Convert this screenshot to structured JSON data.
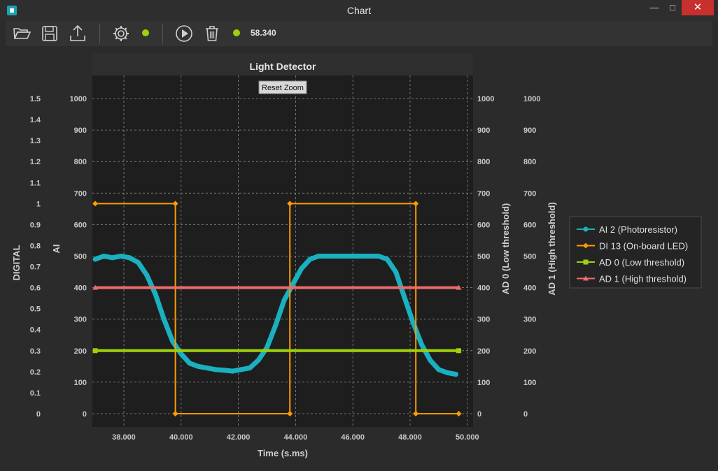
{
  "window": {
    "title": "Chart"
  },
  "toolbar": {
    "icons": [
      "folder-open-icon",
      "save-icon",
      "export-icon",
      "gear-icon",
      "status-dot",
      "play-icon",
      "trash-icon",
      "status-dot"
    ],
    "value": "58.340",
    "status_color": "#9fd10b"
  },
  "reset_zoom": "Reset Zoom",
  "chart_data": {
    "type": "line",
    "title": "Light Detector",
    "xlabel": "Time (s.ms)",
    "xlim": [
      36.9,
      50.2
    ],
    "x_ticks": [
      "38.000",
      "40.000",
      "42.000",
      "44.000",
      "46.000",
      "48.000",
      "50.000"
    ],
    "grid": true,
    "axes": {
      "digital": {
        "label": "DIGITAL",
        "ylim": [
          0,
          1.5
        ],
        "ticks": [
          "0",
          "0.1",
          "0.2",
          "0.3",
          "0.4",
          "0.5",
          "0.6",
          "0.7",
          "0.8",
          "0.9",
          "1",
          "1.1",
          "1.2",
          "1.3",
          "1.4",
          "1.5"
        ]
      },
      "ai": {
        "label": "AI",
        "ylim": [
          0,
          1000
        ],
        "ticks": [
          "0",
          "100",
          "200",
          "300",
          "400",
          "500",
          "600",
          "700",
          "800",
          "900",
          "1000"
        ]
      },
      "ad0": {
        "label": "AD 0 (Low threshold)",
        "ylim": [
          0,
          1000
        ],
        "ticks": [
          "0",
          "100",
          "200",
          "300",
          "400",
          "500",
          "600",
          "700",
          "800",
          "900",
          "1000"
        ]
      },
      "ad1": {
        "label": "AD 1 (High threshold)",
        "ylim": [
          0,
          1000
        ],
        "ticks": [
          "0",
          "100",
          "200",
          "300",
          "400",
          "500",
          "600",
          "700",
          "800",
          "900",
          "1000"
        ]
      }
    },
    "series": [
      {
        "name": "AI 2 (Photoresistor)",
        "axis": "ai",
        "color": "#1ab0bf",
        "marker": "circle",
        "x": [
          37.0,
          37.3,
          37.6,
          37.9,
          38.2,
          38.5,
          38.8,
          39.1,
          39.4,
          39.7,
          40.0,
          40.3,
          40.6,
          40.9,
          41.2,
          41.5,
          41.8,
          42.1,
          42.4,
          42.7,
          43.0,
          43.3,
          43.6,
          43.9,
          44.2,
          44.5,
          44.8,
          45.1,
          45.4,
          45.7,
          46.0,
          46.3,
          46.6,
          46.9,
          47.2,
          47.5,
          47.8,
          48.1,
          48.4,
          48.7,
          49.0,
          49.3,
          49.6
        ],
        "y": [
          490,
          500,
          495,
          500,
          495,
          480,
          440,
          380,
          300,
          230,
          190,
          160,
          150,
          145,
          140,
          138,
          135,
          140,
          145,
          170,
          210,
          280,
          360,
          410,
          460,
          490,
          500,
          500,
          500,
          500,
          500,
          500,
          500,
          500,
          490,
          450,
          370,
          290,
          220,
          170,
          140,
          130,
          125
        ]
      },
      {
        "name": "DI 13 (On-board LED)",
        "axis": "digital",
        "color": "#ff9a00",
        "marker": "diamond",
        "step": true,
        "x": [
          37.0,
          39.8,
          39.8,
          43.8,
          43.8,
          48.2,
          48.2,
          49.7
        ],
        "y": [
          1,
          1,
          0,
          0,
          1,
          1,
          0,
          0
        ]
      },
      {
        "name": "AD 0 (Low threshold)",
        "axis": "ad0",
        "color": "#9fd10b",
        "marker": "square",
        "x": [
          37.0,
          49.7
        ],
        "y": [
          200,
          200
        ]
      },
      {
        "name": "AD 1 (High threshold)",
        "axis": "ad1",
        "color": "#f06a6a",
        "marker": "triangle",
        "x": [
          37.0,
          49.7
        ],
        "y": [
          400,
          400
        ]
      }
    ]
  }
}
